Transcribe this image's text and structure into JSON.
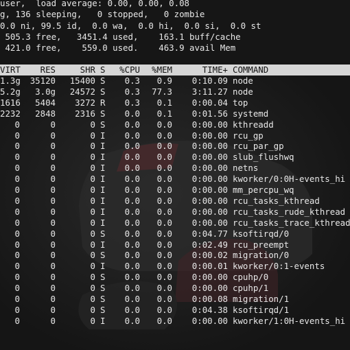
{
  "summary": {
    "tasks_line": "user,  load average: 0.00, 0.00, 0.08",
    "procs_line": "g, 136 sleeping,   0 stopped,   0 zombie",
    "cpu_line": "0.0 ni, 99.5 id,  0.0 wa,  0.0 hi,  0.0 si,  0.0 st",
    "mem_line": " 505.3 free,   3451.4 used,    163.1 buff/cache",
    "swap_line": " 421.0 free,    559.0 used.    463.9 avail Mem"
  },
  "table": {
    "columns": [
      "VIRT",
      "RES",
      "SHR",
      "S",
      "%CPU",
      "%MEM",
      "TIME+",
      "COMMAND"
    ],
    "rows": [
      {
        "virt": "1.3g",
        "res": "35120",
        "shr": "15400",
        "s": "S",
        "cpu": "0.3",
        "mem": "0.9",
        "time": "0:10.09",
        "cmd": "node"
      },
      {
        "virt": "5.2g",
        "res": "3.0g",
        "shr": "24572",
        "s": "S",
        "cpu": "0.3",
        "mem": "77.3",
        "time": "3:11.27",
        "cmd": "node"
      },
      {
        "virt": "1616",
        "res": "5404",
        "shr": "3272",
        "s": "R",
        "cpu": "0.3",
        "mem": "0.1",
        "time": "0:00.04",
        "cmd": "top"
      },
      {
        "virt": "2232",
        "res": "2848",
        "shr": "2316",
        "s": "S",
        "cpu": "0.0",
        "mem": "0.1",
        "time": "0:01.56",
        "cmd": "systemd"
      },
      {
        "virt": "0",
        "res": "0",
        "shr": "0",
        "s": "S",
        "cpu": "0.0",
        "mem": "0.0",
        "time": "0:00.00",
        "cmd": "kthreadd"
      },
      {
        "virt": "0",
        "res": "0",
        "shr": "0",
        "s": "I",
        "cpu": "0.0",
        "mem": "0.0",
        "time": "0:00.00",
        "cmd": "rcu_gp"
      },
      {
        "virt": "0",
        "res": "0",
        "shr": "0",
        "s": "I",
        "cpu": "0.0",
        "mem": "0.0",
        "time": "0:00.00",
        "cmd": "rcu_par_gp"
      },
      {
        "virt": "0",
        "res": "0",
        "shr": "0",
        "s": "I",
        "cpu": "0.0",
        "mem": "0.0",
        "time": "0:00.00",
        "cmd": "slub_flushwq"
      },
      {
        "virt": "0",
        "res": "0",
        "shr": "0",
        "s": "I",
        "cpu": "0.0",
        "mem": "0.0",
        "time": "0:00.00",
        "cmd": "netns"
      },
      {
        "virt": "0",
        "res": "0",
        "shr": "0",
        "s": "I",
        "cpu": "0.0",
        "mem": "0.0",
        "time": "0:00.00",
        "cmd": "kworker/0:0H-events_hi"
      },
      {
        "virt": "0",
        "res": "0",
        "shr": "0",
        "s": "I",
        "cpu": "0.0",
        "mem": "0.0",
        "time": "0:00.00",
        "cmd": "mm_percpu_wq"
      },
      {
        "virt": "0",
        "res": "0",
        "shr": "0",
        "s": "I",
        "cpu": "0.0",
        "mem": "0.0",
        "time": "0:00.00",
        "cmd": "rcu_tasks_kthread"
      },
      {
        "virt": "0",
        "res": "0",
        "shr": "0",
        "s": "I",
        "cpu": "0.0",
        "mem": "0.0",
        "time": "0:00.00",
        "cmd": "rcu_tasks_rude_kthread"
      },
      {
        "virt": "0",
        "res": "0",
        "shr": "0",
        "s": "I",
        "cpu": "0.0",
        "mem": "0.0",
        "time": "0:00.00",
        "cmd": "rcu_tasks_trace_kthread"
      },
      {
        "virt": "0",
        "res": "0",
        "shr": "0",
        "s": "S",
        "cpu": "0.0",
        "mem": "0.0",
        "time": "0:04.77",
        "cmd": "ksoftirqd/0"
      },
      {
        "virt": "0",
        "res": "0",
        "shr": "0",
        "s": "I",
        "cpu": "0.0",
        "mem": "0.0",
        "time": "0:02.49",
        "cmd": "rcu_preempt"
      },
      {
        "virt": "0",
        "res": "0",
        "shr": "0",
        "s": "S",
        "cpu": "0.0",
        "mem": "0.0",
        "time": "0:00.02",
        "cmd": "migration/0"
      },
      {
        "virt": "0",
        "res": "0",
        "shr": "0",
        "s": "I",
        "cpu": "0.0",
        "mem": "0.0",
        "time": "0:00.01",
        "cmd": "kworker/0:1-events"
      },
      {
        "virt": "0",
        "res": "0",
        "shr": "0",
        "s": "S",
        "cpu": "0.0",
        "mem": "0.0",
        "time": "0:00.00",
        "cmd": "cpuhp/0"
      },
      {
        "virt": "0",
        "res": "0",
        "shr": "0",
        "s": "S",
        "cpu": "0.0",
        "mem": "0.0",
        "time": "0:00.00",
        "cmd": "cpuhp/1"
      },
      {
        "virt": "0",
        "res": "0",
        "shr": "0",
        "s": "S",
        "cpu": "0.0",
        "mem": "0.0",
        "time": "0:00.08",
        "cmd": "migration/1"
      },
      {
        "virt": "0",
        "res": "0",
        "shr": "0",
        "s": "S",
        "cpu": "0.0",
        "mem": "0.0",
        "time": "0:04.38",
        "cmd": "ksoftirqd/1"
      },
      {
        "virt": "0",
        "res": "0",
        "shr": "0",
        "s": "I",
        "cpu": "0.0",
        "mem": "0.0",
        "time": "0:00.00",
        "cmd": "kworker/1:0H-events_hi"
      }
    ]
  },
  "colors": {
    "background": "#151515",
    "text": "#e8e8e8",
    "header_bar": "#d6d6d6",
    "header_text": "#111111"
  }
}
